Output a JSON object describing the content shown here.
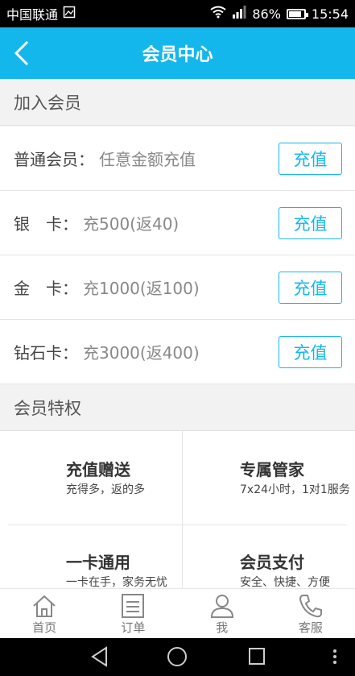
{
  "status_bar": {
    "carrier": "中国联通",
    "battery": "86%",
    "battery_level": 0.86,
    "time": "15:54"
  },
  "header": {
    "title": "会员中心"
  },
  "join_section": {
    "title": "加入会员"
  },
  "memberships": [
    {
      "label": "普通会员：",
      "desc": "任意金额充值",
      "button": "充值"
    },
    {
      "label": "银　卡：",
      "desc": "充500(返40)",
      "button": "充值"
    },
    {
      "label": "金　卡：",
      "desc": "充1000(返100)",
      "button": "充值"
    },
    {
      "label": "钻石卡：",
      "desc": "充3000(返400)",
      "button": "充值"
    }
  ],
  "privileges_section": {
    "title": "会员特权"
  },
  "privileges": [
    {
      "title": "充值赠送",
      "desc": "充得多，返的多"
    },
    {
      "title": "专属管家",
      "desc": "7x24小时，1对1服务"
    },
    {
      "title": "一卡通用",
      "desc": "一卡在手，家务无忧"
    },
    {
      "title": "会员支付",
      "desc": "安全、快捷、方便"
    }
  ],
  "tabbar": [
    {
      "label": "首页",
      "icon": "home-icon"
    },
    {
      "label": "订单",
      "icon": "order-icon"
    },
    {
      "label": "我",
      "icon": "user-icon"
    },
    {
      "label": "客服",
      "icon": "phone-icon"
    }
  ],
  "colors": {
    "accent": "#14b7ec",
    "background": "#f2f2f2"
  }
}
